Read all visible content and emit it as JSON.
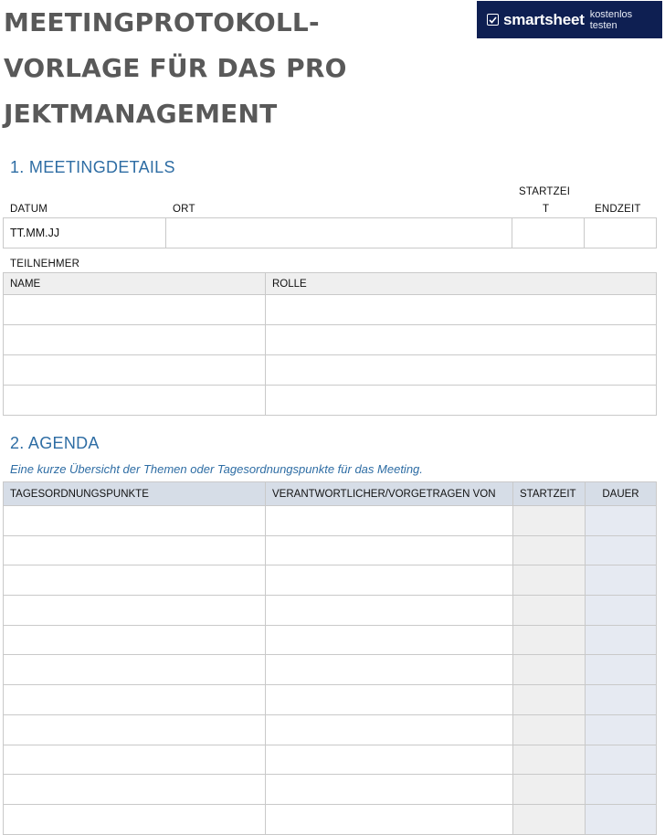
{
  "document": {
    "title_lines": [
      "MEETINGPROTOKOLL-",
      "VORLAGE FÜR DAS PRO",
      "JEKTMANAGEMENT"
    ]
  },
  "badge": {
    "brand": "smartsheet",
    "cta": "kostenlos testen",
    "bg_color": "#0e1f52"
  },
  "section1": {
    "heading": "1. MEETINGDETAILS",
    "labels": {
      "date": "DATUM",
      "location": "ORT",
      "start_line1": "STARTZEI",
      "start_line2": "T",
      "end": "ENDZEIT"
    },
    "values": {
      "date": "TT.MM.JJ",
      "location": "",
      "start": "",
      "end": ""
    },
    "participants_label": "TEILNEHMER",
    "participants_columns": [
      "NAME",
      "ROLLE"
    ],
    "participants_rows": [
      [
        "",
        ""
      ],
      [
        "",
        ""
      ],
      [
        "",
        ""
      ],
      [
        "",
        ""
      ]
    ]
  },
  "section2": {
    "heading": "2. AGENDA",
    "description": "Eine kurze Übersicht der Themen oder Tagesordnungspunkte für das Meeting.",
    "columns": [
      "TAGESORDNUNGSPUNKTE",
      "VERANTWORTLICHER/VORGETRAGEN VON",
      "STARTZEIT",
      "DAUER"
    ],
    "rows": [
      [
        "",
        "",
        "",
        ""
      ],
      [
        "",
        "",
        "",
        ""
      ],
      [
        "",
        "",
        "",
        ""
      ],
      [
        "",
        "",
        "",
        ""
      ],
      [
        "",
        "",
        "",
        ""
      ],
      [
        "",
        "",
        "",
        ""
      ],
      [
        "",
        "",
        "",
        ""
      ],
      [
        "",
        "",
        "",
        ""
      ],
      [
        "",
        "",
        "",
        ""
      ],
      [
        "",
        "",
        "",
        ""
      ],
      [
        "",
        "",
        "",
        ""
      ]
    ]
  },
  "colors": {
    "heading_blue": "#2e6da4",
    "title_gray": "#595959",
    "header_gray": "#efefef",
    "header_blue": "#d6dde7"
  }
}
